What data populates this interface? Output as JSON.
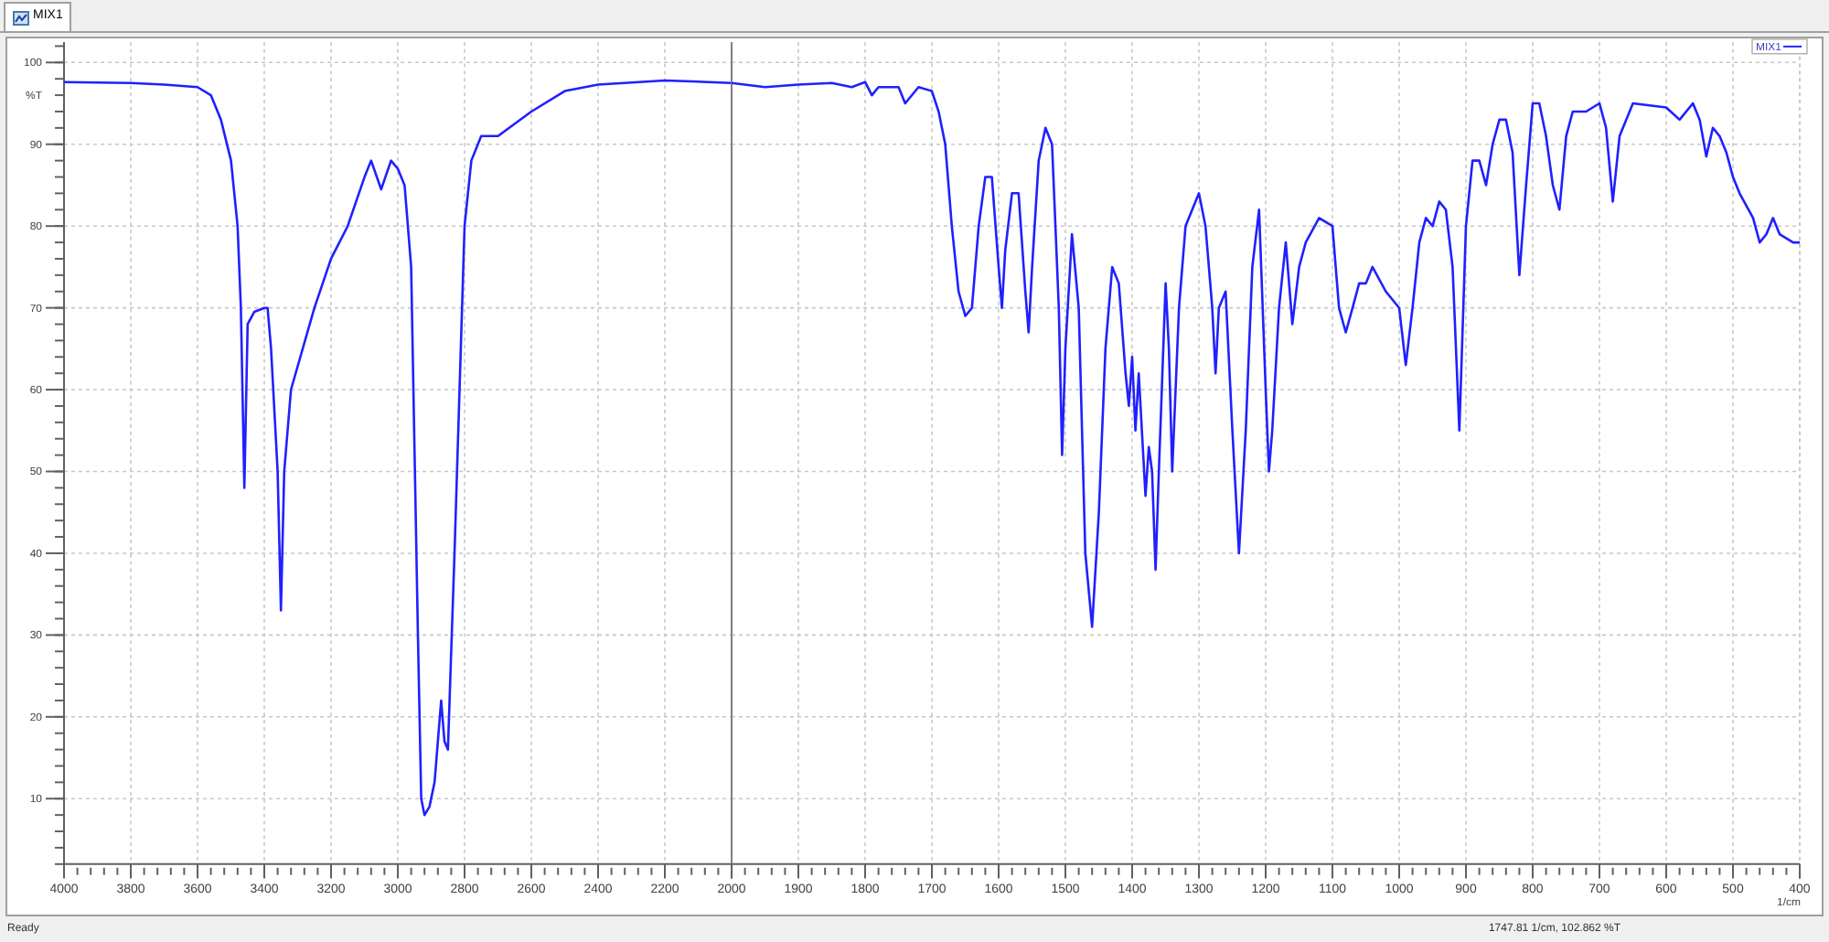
{
  "tabs": [
    {
      "label": "MIX1",
      "selected": true
    }
  ],
  "chart": {
    "panels": [
      {
        "chart_data": {
          "type": "line",
          "ylabel": "%T",
          "x": [
            4000,
            3800,
            3700,
            3600,
            3560,
            3530,
            3500,
            3480,
            3470,
            3460,
            3450,
            3430,
            3400,
            3390,
            3380,
            3360,
            3350,
            3340,
            3320,
            3250,
            3200,
            3150,
            3100,
            3080,
            3050,
            3020,
            3000,
            2980,
            2960,
            2940,
            2930,
            2920,
            2905,
            2890,
            2870,
            2860,
            2850,
            2830,
            2800,
            2780,
            2750,
            2700,
            2600,
            2500,
            2400,
            2200,
            2000
          ],
          "series": [
            {
              "color": "#2020ff",
              "values": [
                97.6,
                97.5,
                97.3,
                97,
                96,
                93,
                88,
                80,
                70,
                48,
                68,
                69.5,
                70,
                70,
                65,
                50,
                33,
                50,
                60,
                70,
                76,
                80,
                86,
                88,
                84.5,
                88,
                87,
                85,
                75,
                30,
                10,
                8,
                9,
                12,
                22,
                17,
                16,
                40,
                80,
                88,
                91,
                91,
                94,
                96.5,
                97.3,
                97.8,
                97.5
              ]
            }
          ],
          "xticks": [
            4000,
            3800,
            3600,
            3400,
            3200,
            3000,
            2800,
            2600,
            2400,
            2200
          ],
          "yticks": [
            10,
            20,
            30,
            40,
            50,
            60,
            70,
            80,
            90,
            100
          ],
          "xlim": [
            4000,
            2000
          ],
          "grid": true,
          "ylim": [
            2,
            102.5
          ]
        }
      },
      {
        "chart_data": {
          "type": "line",
          "xlabel": "1/cm",
          "x": [
            2000,
            1950,
            1900,
            1850,
            1820,
            1800,
            1790,
            1780,
            1750,
            1740,
            1720,
            1700,
            1690,
            1680,
            1670,
            1660,
            1650,
            1640,
            1630,
            1620,
            1610,
            1600,
            1595,
            1590,
            1580,
            1570,
            1560,
            1555,
            1550,
            1540,
            1530,
            1520,
            1510,
            1505,
            1500,
            1490,
            1480,
            1470,
            1460,
            1450,
            1440,
            1430,
            1420,
            1410,
            1405,
            1400,
            1395,
            1390,
            1380,
            1375,
            1370,
            1365,
            1360,
            1350,
            1345,
            1340,
            1330,
            1320,
            1300,
            1290,
            1280,
            1275,
            1270,
            1260,
            1250,
            1240,
            1230,
            1220,
            1210,
            1200,
            1195,
            1190,
            1180,
            1170,
            1160,
            1150,
            1140,
            1120,
            1100,
            1090,
            1080,
            1070,
            1060,
            1050,
            1040,
            1020,
            1000,
            990,
            980,
            970,
            960,
            950,
            940,
            930,
            920,
            910,
            900,
            890,
            880,
            870,
            860,
            850,
            840,
            830,
            820,
            810,
            800,
            790,
            780,
            770,
            760,
            750,
            740,
            720,
            700,
            690,
            680,
            670,
            650,
            600,
            580,
            560,
            550,
            540,
            530,
            520,
            510,
            500,
            490,
            470,
            460,
            450,
            440,
            430,
            410,
            400
          ],
          "series": [
            {
              "name": "MIX1",
              "color": "#2020ff",
              "values": [
                97.5,
                97,
                97.3,
                97.5,
                97,
                97.6,
                96,
                97,
                97,
                95,
                97,
                96.5,
                94,
                90,
                80,
                72,
                69,
                70,
                80,
                86,
                86,
                75,
                70,
                77,
                84,
                84,
                72,
                67,
                75,
                88,
                92,
                90,
                70,
                52,
                65,
                79,
                70,
                40,
                31,
                45,
                65,
                75,
                73,
                62,
                58,
                64,
                55,
                62,
                47,
                53,
                50,
                38,
                50,
                73,
                65,
                50,
                70,
                80,
                84,
                80,
                70,
                62,
                70,
                72,
                55,
                40,
                55,
                75,
                82,
                60,
                50,
                55,
                70,
                78,
                68,
                75,
                78,
                81,
                80,
                70,
                67,
                70,
                73,
                73,
                75,
                72,
                70,
                63,
                70,
                78,
                81,
                80,
                83,
                82,
                75,
                55,
                80,
                88,
                88,
                85,
                90,
                93,
                93,
                89,
                74,
                85,
                95,
                95,
                91,
                85,
                82,
                91,
                94,
                94,
                95,
                92,
                83,
                91,
                95,
                94.5,
                93,
                95,
                93,
                88.5,
                92,
                91,
                89,
                86,
                84,
                81,
                78,
                79,
                81,
                79,
                78,
                78
              ]
            }
          ],
          "xticks": [
            2000,
            1900,
            1800,
            1700,
            1600,
            1500,
            1400,
            1300,
            1200,
            1100,
            1000,
            900,
            800,
            700,
            600,
            500,
            400
          ],
          "xlim": [
            2000,
            400
          ],
          "grid": true,
          "ylim": [
            2,
            102.5
          ]
        }
      }
    ]
  },
  "status_bar": {
    "message": "Ready",
    "position": "1747.81 1/cm, 102.862 %T"
  }
}
